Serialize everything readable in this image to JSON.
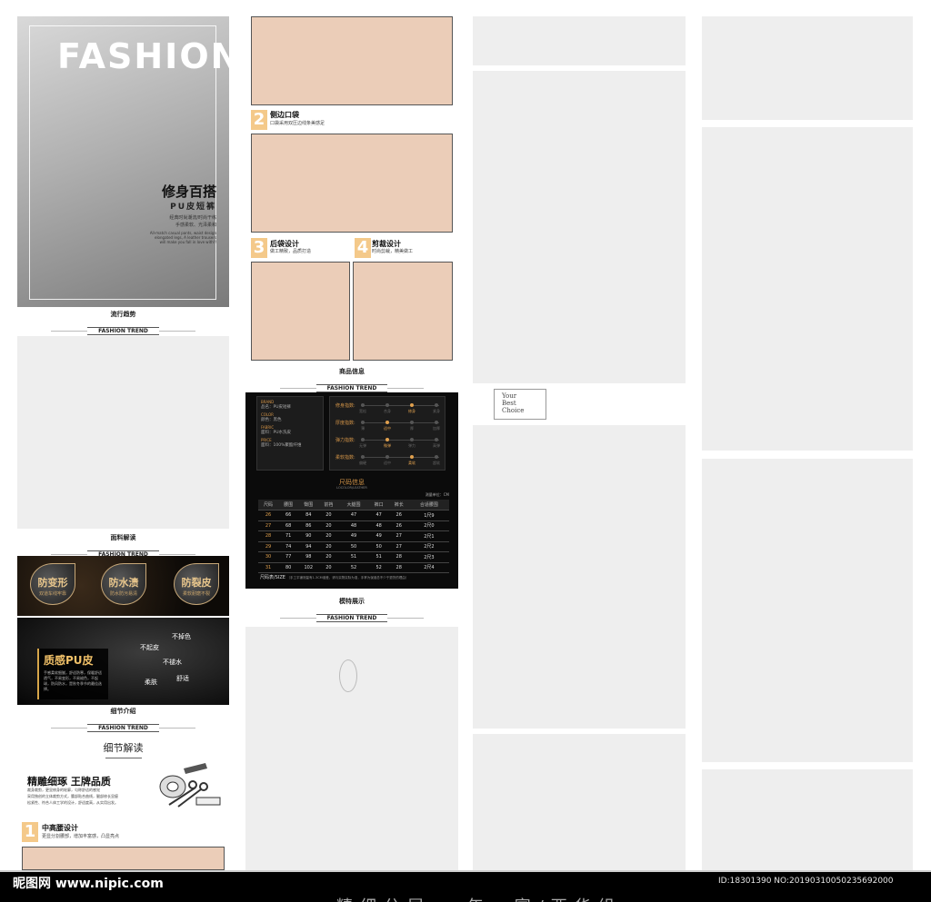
{
  "hero": {
    "title": "FASHION",
    "cn_title": "修身百搭",
    "sub": "PU皮短裤",
    "line1": "经典时尚潮流/时尚干练",
    "line2": "手感柔软、光泽柔和",
    "en1": "All-match casual pants, waist design",
    "en2": "elongated legs, A leather trousers",
    "en3": "will make you fall in love with!!"
  },
  "sections": {
    "trend_cn": "流行趋势",
    "trend_en": "FASHION TREND",
    "fabric_cn": "面料解读",
    "detail_cn": "细节介绍",
    "product_cn": "商品信息",
    "model_cn": "模特展示"
  },
  "fabric": {
    "badges": [
      {
        "title": "防变形",
        "sub": "双道车线牢靠"
      },
      {
        "title": "防水渍",
        "sub": "防水防污易清"
      },
      {
        "title": "防裂皮",
        "sub": "柔软耐磨不裂"
      }
    ],
    "leather_title": "质感PU皮",
    "leather_text": "手感柔软细腻，舒适防寒，保暖舒适透气，不易变形，不易褪色，不起球，防风防水，是秋冬季节的最佳选择。",
    "tags": [
      "不掉色",
      "不起皮",
      "不褪水",
      "柔肤",
      "舒适"
    ]
  },
  "detail": {
    "title": "细节解读",
    "headline": "精雕细琢 王牌品质",
    "desc1": "裁身裁剪，更显修身的轮廓，匀称舒适的感觉",
    "desc2": "采用独创的立体裁剪方式，腰部贴合曲线，腿部修长显瘦",
    "desc3": "松紧性、符合人体工学的设计，舒适度高，从实用出发。"
  },
  "features": [
    {
      "num": "1",
      "title": "中高腰设计",
      "desc": "更显分割腰部，增加丰富感，凸显亮点"
    },
    {
      "num": "2",
      "title": "侧边口袋",
      "desc": "口袋采用双压边线条美感足"
    },
    {
      "num": "3",
      "title": "后袋设计",
      "desc": "做工精致，品质打造"
    },
    {
      "num": "4",
      "title": "剪裁设计",
      "desc": "时尚剪裁，精美做工"
    }
  ],
  "specs": {
    "rows": [
      {
        "k": "BRAND",
        "v": "品名：PU皮短裤"
      },
      {
        "k": "COLOR",
        "v": "颜色：黑色"
      },
      {
        "k": "FABRIC",
        "v": "面料：PU水洗皮"
      },
      {
        "k": "PRICE",
        "v": "面料：100%聚酯纤维"
      }
    ],
    "ratings": [
      {
        "label": "修身指数:",
        "levels": [
          "宽松",
          "合身",
          "修身",
          "紧身"
        ],
        "on": 2
      },
      {
        "label": "厚度指数:",
        "levels": [
          "薄",
          "适中",
          "厚",
          "加厚"
        ],
        "on": 1
      },
      {
        "label": "弹力指数:",
        "levels": [
          "无弹",
          "微弹",
          "弹力",
          "高弹"
        ],
        "on": 1
      },
      {
        "label": "柔软指数:",
        "levels": [
          "偏硬",
          "适中",
          "柔软",
          "超软"
        ],
        "on": 2
      }
    ]
  },
  "size_chart": {
    "title": "尺码信息",
    "sub": "LOCOLOR/LEATHER",
    "unit": "测量单位：CM",
    "headers": [
      "尺码",
      "腰围",
      "臀围",
      "前裆",
      "大腿围",
      "裤口",
      "裤长",
      "合适腰围"
    ],
    "rows": [
      [
        "26",
        "66",
        "84",
        "20",
        "47",
        "47",
        "26",
        "1尺9"
      ],
      [
        "27",
        "68",
        "86",
        "20",
        "48",
        "48",
        "26",
        "2尺0"
      ],
      [
        "28",
        "71",
        "90",
        "20",
        "49",
        "49",
        "27",
        "2尺1"
      ],
      [
        "29",
        "74",
        "94",
        "20",
        "50",
        "50",
        "27",
        "2尺2"
      ],
      [
        "30",
        "77",
        "98",
        "20",
        "51",
        "51",
        "28",
        "2尺3"
      ],
      [
        "31",
        "80",
        "102",
        "20",
        "52",
        "52",
        "28",
        "2尺4"
      ]
    ],
    "note_title": "尺码表/SIZE",
    "note": "（手工平铺测量有1-3CM误差，请与实物实际为准，手掌为误误总不少于退货的理由）"
  },
  "choice": {
    "l1": "Your",
    "l2": "Best",
    "l3": "Choice"
  },
  "watermark": {
    "left": "昵图网 www.nipic.com",
    "right": "ID:18301390 NO:20190310050235692000",
    "bottom": "精细分层 一年一富/西华组"
  }
}
